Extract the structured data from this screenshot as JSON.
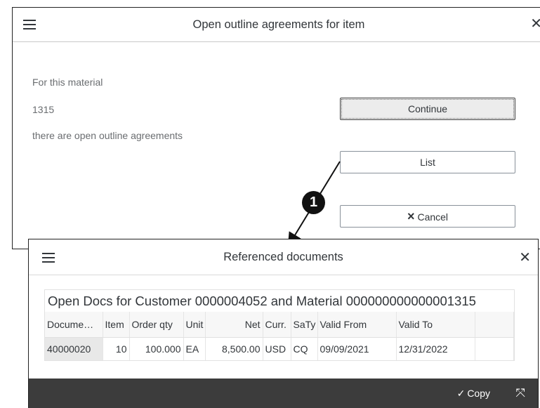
{
  "dialog1": {
    "title": "Open outline agreements for item",
    "line1": "For this material",
    "line2": "1315",
    "line3": "there are open outline agreements",
    "continue_label": "Continue",
    "list_label": "List",
    "cancel_label": "Cancel",
    "cancel_icon": "×"
  },
  "callout": {
    "label": "1"
  },
  "dialog2": {
    "title": "Referenced documents",
    "caption": "Open Docs for Customer 0000004052 and Material 000000000000001315",
    "columns": [
      "Docume…",
      "Item",
      "Order qty",
      "Unit",
      "Net",
      "Curr.",
      "SaTy",
      "Valid From",
      "Valid To",
      ""
    ],
    "rows": [
      [
        "40000020",
        "10",
        "100.000",
        "EA",
        "8,500.00",
        "USD",
        "CQ",
        "09/09/2021",
        "12/31/2022",
        ""
      ]
    ],
    "copy_label": "Copy",
    "copy_icon": "✓"
  },
  "icons": {
    "menu": "menu-icon",
    "close": "close-icon",
    "copy": "check-icon",
    "collapse": "collapse-icon"
  },
  "colors": {
    "footer": "#3c3c3c",
    "text": "#32363a",
    "callout": "#111111"
  }
}
